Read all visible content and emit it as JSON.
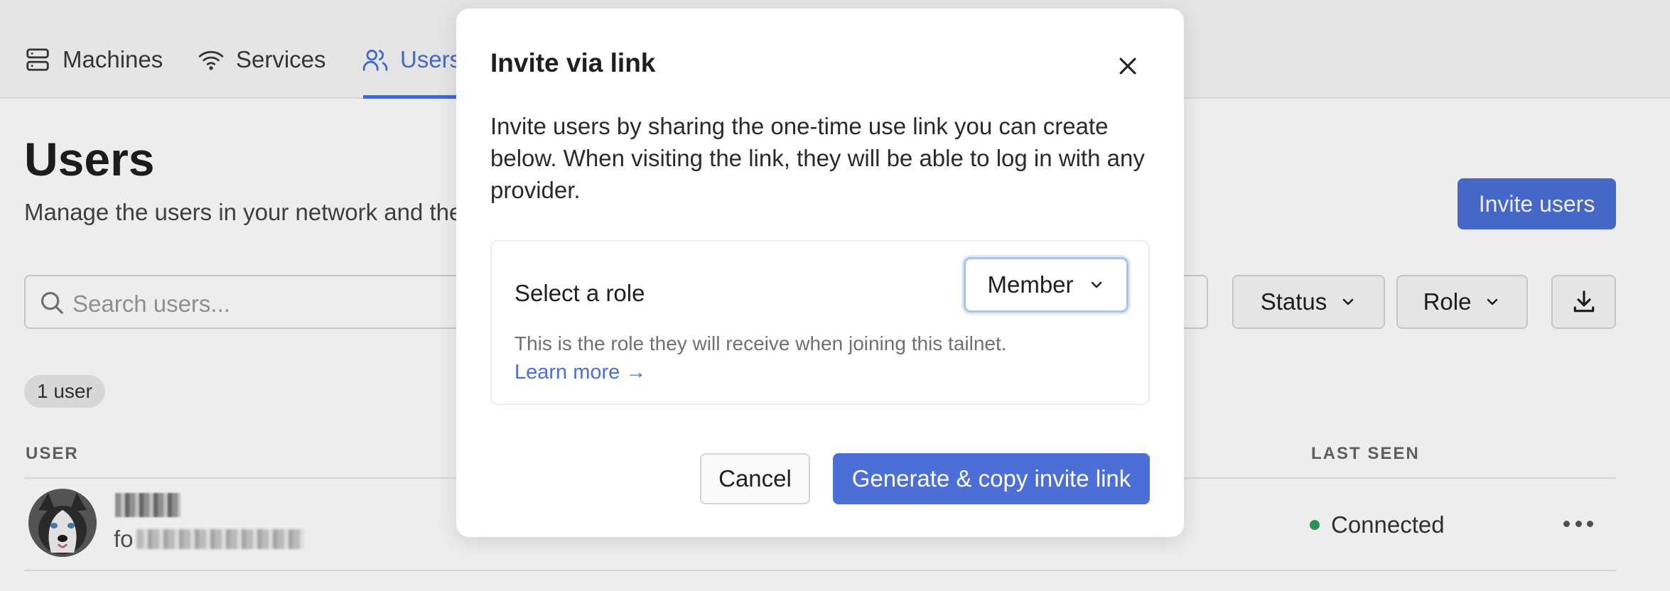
{
  "nav": {
    "tabs": [
      {
        "label": "Machines",
        "icon": "server-icon"
      },
      {
        "label": "Services",
        "icon": "wifi-icon"
      },
      {
        "label": "Users",
        "icon": "users-icon"
      }
    ],
    "active_tab": "Users",
    "accent_color": "#4b6fd6"
  },
  "page": {
    "title": "Users",
    "subtitle": "Manage the users in your network and the",
    "invite_button_label": "Invite users"
  },
  "toolbar": {
    "search_placeholder": "Search users...",
    "status_filter_label": "Status",
    "role_filter_label": "Role",
    "download_icon": "download-icon"
  },
  "users_table": {
    "count_label": "1 user",
    "columns": {
      "user": "USER",
      "last_seen": "LAST SEEN"
    },
    "rows": [
      {
        "email_prefix": "fo",
        "last_seen": "Connected",
        "status_color": "#2f9e5c"
      }
    ]
  },
  "modal": {
    "title": "Invite via link",
    "description": "Invite users by sharing the one-time use link you can create below. When visiting the link, they will be able to log in with any provider.",
    "role_section": {
      "label": "Select a role",
      "selected_role": "Member",
      "hint": "This is the role they will receive when joining this tailnet.",
      "learn_more": "Learn more →"
    },
    "cancel_label": "Cancel",
    "generate_label": "Generate & copy invite link"
  }
}
